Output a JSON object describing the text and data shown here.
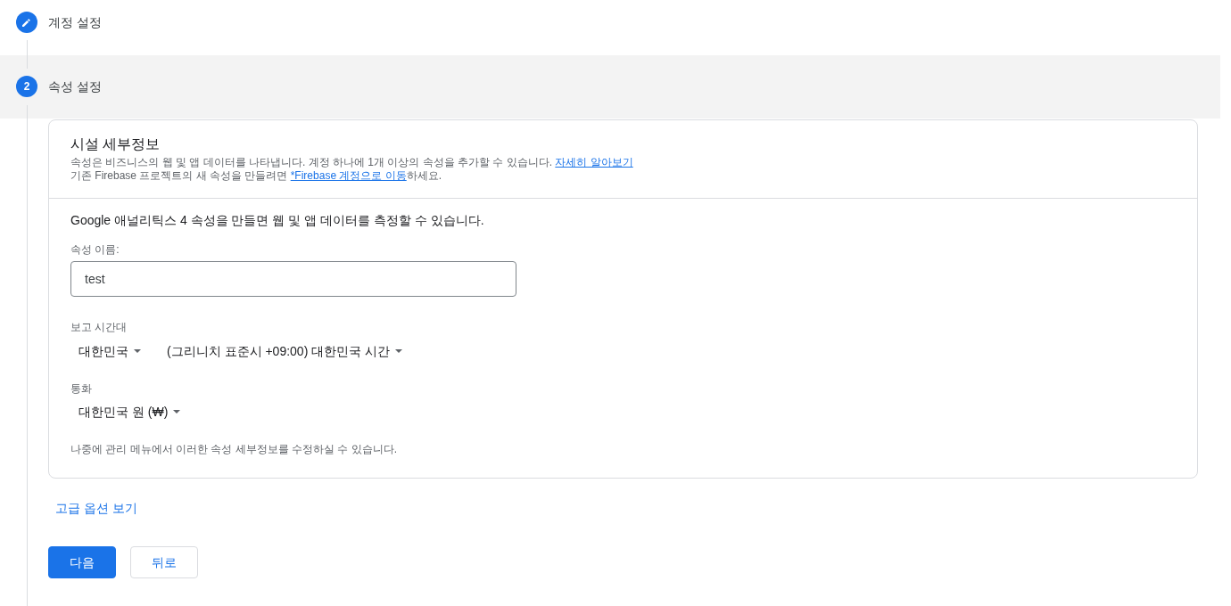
{
  "steps": [
    {
      "kind": "edit",
      "label": "계정 설정",
      "selected": false
    },
    {
      "kind": "number",
      "number": "2",
      "label": "속성 설정",
      "selected": true
    }
  ],
  "card": {
    "title": "시설 세부정보",
    "description": [
      [
        {
          "kind": "text",
          "text": "속성은 비즈니스의 웹 및 앱 데이터를 나타냅니다. 계정 하나에 1개 이상의 속성을 추가할 수 있습니다. "
        },
        {
          "kind": "link",
          "text": "자세히 알아보기"
        }
      ],
      [
        {
          "kind": "text",
          "text": "기존 Firebase 프로젝트의 새 속성을 만들려면 "
        },
        {
          "kind": "link",
          "text": "*Firebase 계정으로 이동"
        },
        {
          "kind": "text",
          "text": "하세요."
        }
      ]
    ],
    "intro": "Google 애널리틱스 4 속성을 만들면 웹 및 앱 데이터를 측정할 수 있습니다.",
    "property_name": {
      "label": "속성 이름:",
      "value": "test"
    },
    "time_zone": {
      "label": "보고 시간대",
      "dropdowns": [
        {
          "value": "대한민국"
        },
        {
          "value": "(그리니치 표준시 +09:00) 대한민국 시간"
        }
      ]
    },
    "currency": {
      "label": "통화",
      "dropdowns": [
        {
          "value": "대한민국 원 (₩)"
        }
      ]
    },
    "note": "나중에 관리 메뉴에서 이러한 속성 세부정보를 수정하실 수 있습니다."
  },
  "advanced_link": "고급 옵션 보기",
  "buttons": [
    {
      "kind": "primary",
      "label": "다음"
    },
    {
      "kind": "secondary",
      "label": "뒤로"
    }
  ]
}
